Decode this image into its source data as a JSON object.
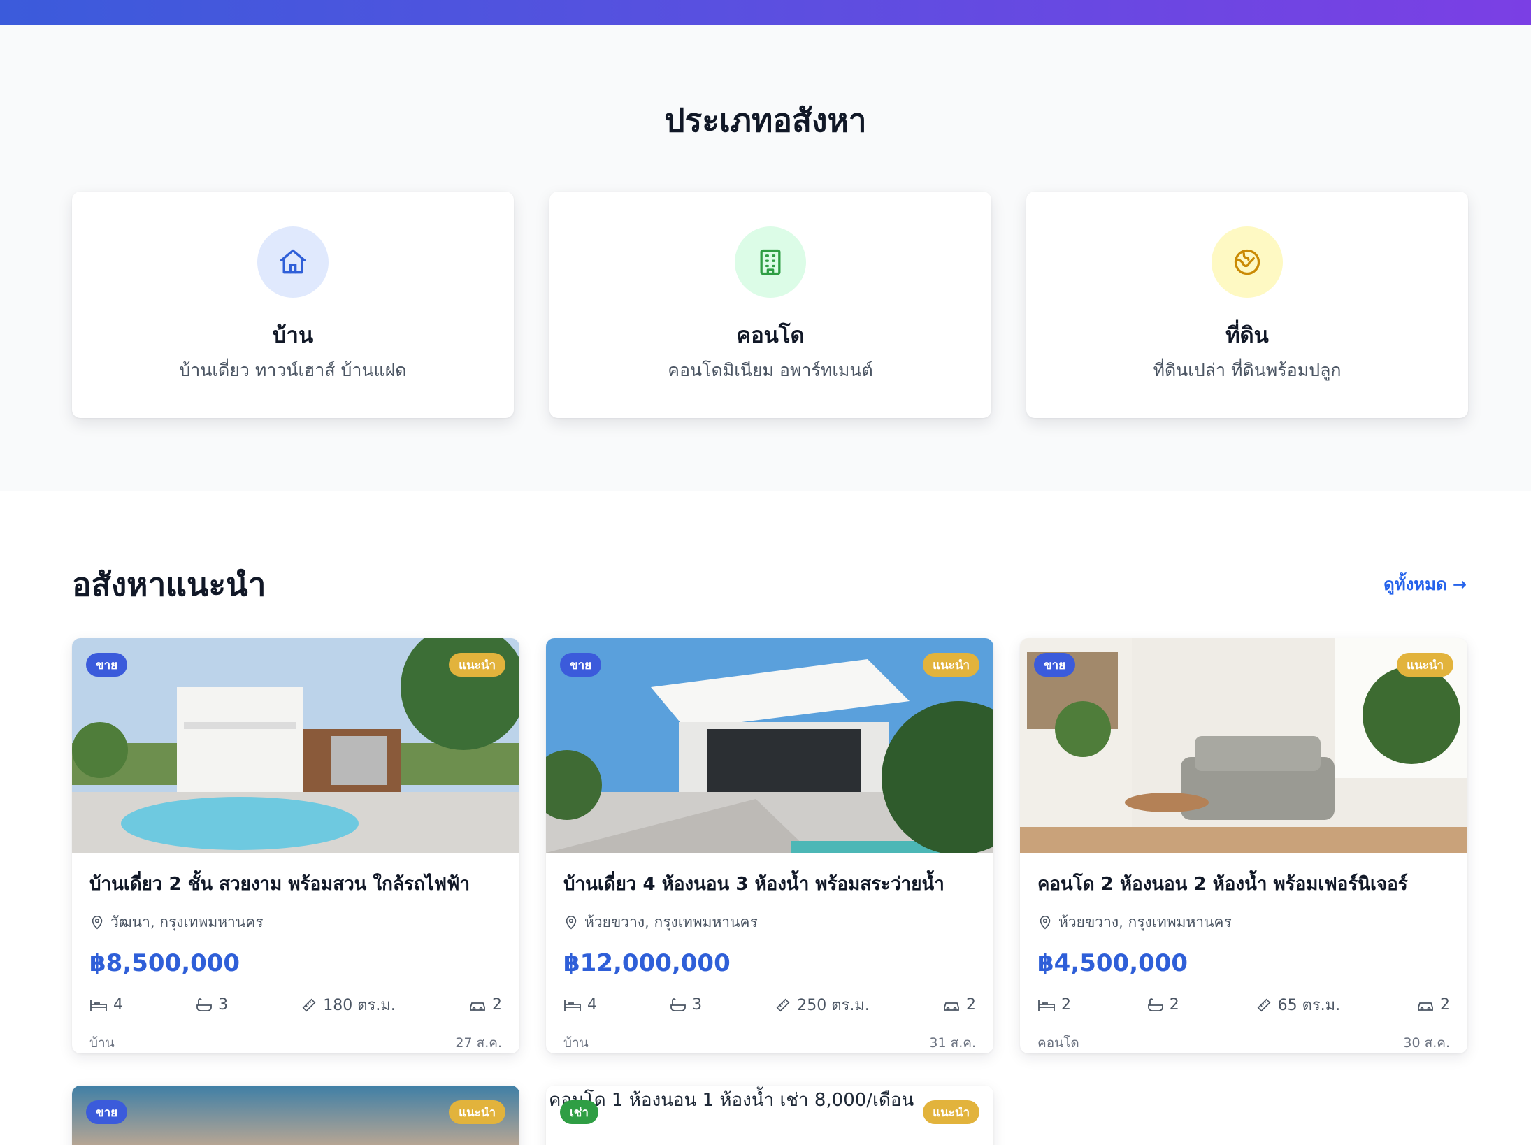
{
  "categories": {
    "title": "ประเภทอสังหา",
    "items": [
      {
        "name": "บ้าน",
        "desc": "บ้านเดี่ยว ทาวน์เฮาส์ บ้านแฝด",
        "icon": "home-icon",
        "bg": "#e0e9fd",
        "color": "#2f5fd8"
      },
      {
        "name": "คอนโด",
        "desc": "คอนโดมิเนียม อพาร์ทเมนต์",
        "icon": "building-icon",
        "bg": "#dcfce7",
        "color": "#2f9e44"
      },
      {
        "name": "ที่ดิน",
        "desc": "ที่ดินเปล่า ที่ดินพร้อมปลูก",
        "icon": "globe-icon",
        "bg": "#fef9c3",
        "color": "#ca8a04"
      }
    ]
  },
  "featured": {
    "title": "อสังหาแนะนำ",
    "view_all": "ดูทั้งหมด →"
  },
  "listings": [
    {
      "type_badge": "ขาย",
      "featured_badge": "แนะนำ",
      "title": "บ้านเดี่ยว 2 ชั้น สวยงาม พร้อมสวน ใกล้รถไฟฟ้า",
      "location": "วัฒนา, กรุงเทพมหานคร",
      "price": "฿8,500,000",
      "beds": "4",
      "baths": "3",
      "area": "180 ตร.ม.",
      "parking": "2",
      "category": "บ้าน",
      "date": "27 ส.ค."
    },
    {
      "type_badge": "ขาย",
      "featured_badge": "แนะนำ",
      "title": "บ้านเดี่ยว 4 ห้องนอน 3 ห้องน้ำ พร้อมสระว่ายน้ำ",
      "location": "ห้วยขวาง, กรุงเทพมหานคร",
      "price": "฿12,000,000",
      "beds": "4",
      "baths": "3",
      "area": "250 ตร.ม.",
      "parking": "2",
      "category": "บ้าน",
      "date": "31 ส.ค."
    },
    {
      "type_badge": "ขาย",
      "featured_badge": "แนะนำ",
      "title": "คอนโด 2 ห้องนอน 2 ห้องน้ำ พร้อมเฟอร์นิเจอร์",
      "location": "ห้วยขวาง, กรุงเทพมหานคร",
      "price": "฿4,500,000",
      "beds": "2",
      "baths": "2",
      "area": "65 ตร.ม.",
      "parking": "2",
      "category": "คอนโด",
      "date": "30 ส.ค."
    },
    {
      "type_badge": "ขาย",
      "featured_badge": "แนะนำ"
    },
    {
      "type_badge": "เช่า",
      "featured_badge": "แนะนำ",
      "image_alt": "คอนโด 1 ห้องนอน 1 ห้องน้ำ เช่า 8,000/เดือน"
    }
  ]
}
